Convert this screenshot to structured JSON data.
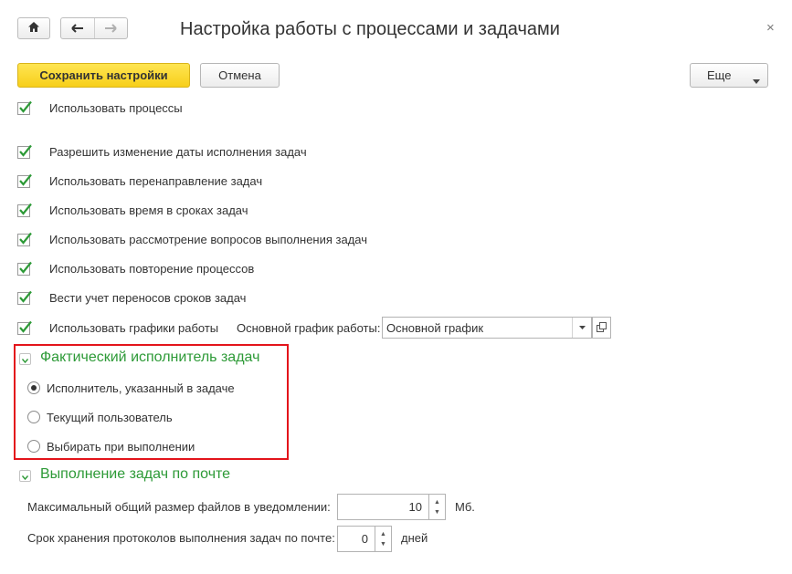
{
  "window": {
    "title": "Настройка работы с процессами и задачами",
    "close_glyph": "×"
  },
  "nav": {
    "home_icon": "home-icon",
    "back_icon": "arrow-left-icon",
    "forward_icon": "arrow-right-icon"
  },
  "toolbar": {
    "save_label": "Сохранить настройки",
    "cancel_label": "Отмена",
    "more_label": "Еще"
  },
  "settings": {
    "use_processes": "Использовать процессы",
    "allow_due_date_change": "Разрешить изменение даты исполнения задач",
    "use_task_redirection": "Использовать перенаправление задач",
    "use_time_in_deadlines": "Использовать время в сроках задач",
    "use_questions_review": "Использовать рассмотрение вопросов выполнения задач",
    "use_process_repeat": "Использовать повторение процессов",
    "track_deadline_shifts": "Вести учет переносов сроков задач",
    "use_work_schedules": "Использовать графики работы",
    "main_schedule_label": "Основной график работы:",
    "main_schedule_value": "Основной график"
  },
  "actual_performer": {
    "title": "Фактический исполнитель задач",
    "options": [
      "Исполнитель, указанный в задаче",
      "Текущий пользователь",
      "Выбирать при выполнении"
    ],
    "selected_index": 0
  },
  "email_tasks": {
    "title": "Выполнение задач по почте",
    "max_size_label": "Максимальный общий размер файлов в уведомлении:",
    "max_size_value": "10",
    "max_size_unit": "Мб.",
    "log_retention_label": "Срок хранения протоколов выполнения задач по почте:",
    "log_retention_value": "0",
    "log_retention_unit": "дней"
  },
  "colors": {
    "accent_green": "#2d9a37",
    "highlight_red": "#e3141b",
    "primary_yellow": "#f7cf1a"
  }
}
